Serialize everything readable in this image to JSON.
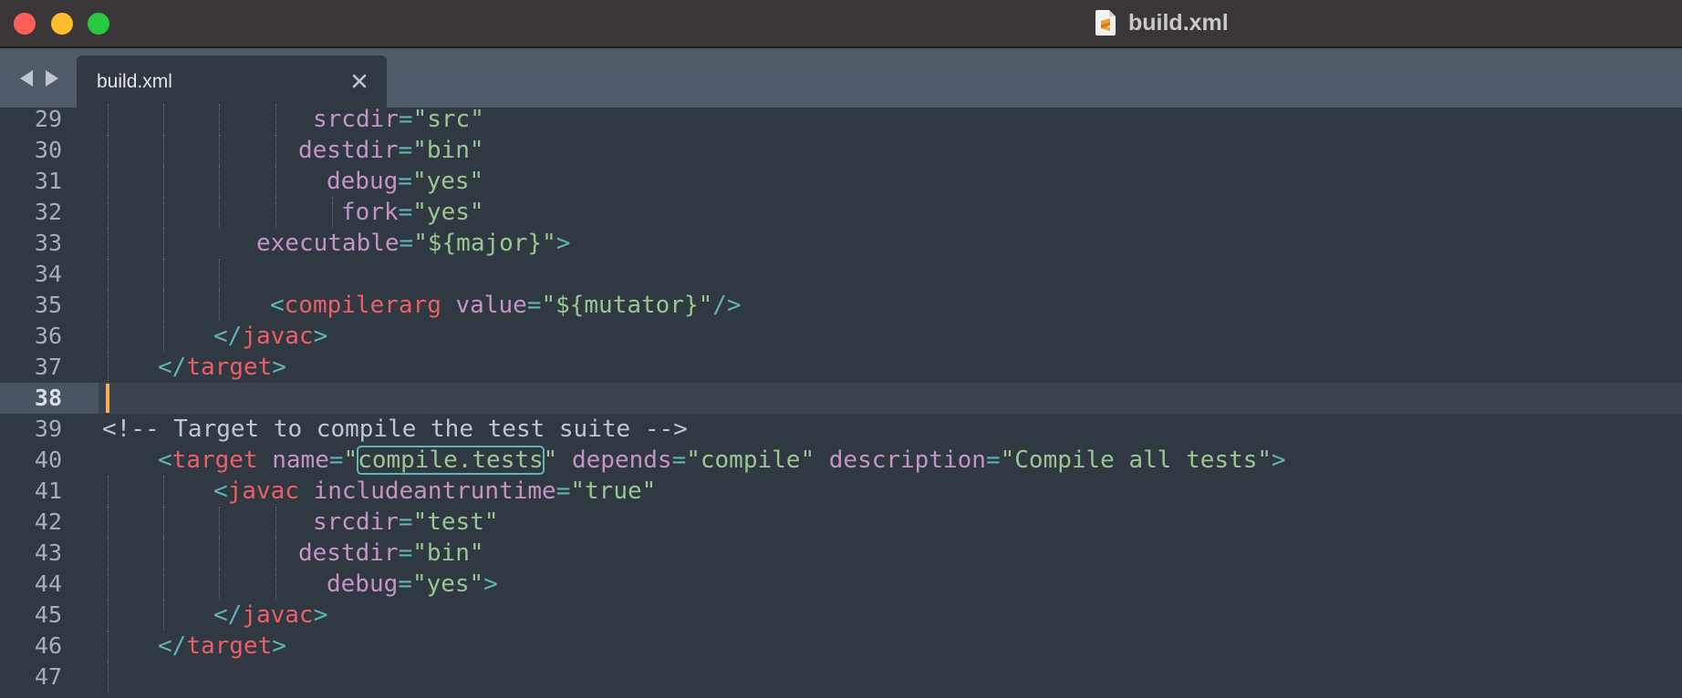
{
  "window": {
    "title": "build.xml",
    "file_icon": "sublime-text-file-icon",
    "controls": [
      "close",
      "minimize",
      "zoom"
    ]
  },
  "tabbar": {
    "nav_back_icon": "triangle-left-icon",
    "nav_forward_icon": "triangle-right-icon",
    "active_tab": {
      "label": "build.xml",
      "close_icon": "close-x-icon"
    }
  },
  "editor": {
    "current_line": "38",
    "colors": {
      "background": "#303841",
      "tag": "#ec5f67",
      "attribute": "#c594c5",
      "string": "#99c794",
      "punctuation": "#5fb4b4",
      "comment": "#c0c5ce",
      "caret": "#f9ae58"
    },
    "lines": [
      {
        "num": "29",
        "tokens": [
          {
            "t": "attr",
            "v": "srcdir"
          },
          {
            "t": "punct",
            "v": "="
          },
          {
            "t": "str",
            "v": "\"src\""
          }
        ]
      },
      {
        "num": "30",
        "tokens": [
          {
            "t": "attr",
            "v": "destdir"
          },
          {
            "t": "punct",
            "v": "="
          },
          {
            "t": "str",
            "v": "\"bin\""
          }
        ]
      },
      {
        "num": "31",
        "tokens": [
          {
            "t": "attr",
            "v": "debug"
          },
          {
            "t": "punct",
            "v": "="
          },
          {
            "t": "str",
            "v": "\"yes\""
          }
        ]
      },
      {
        "num": "32",
        "tokens": [
          {
            "t": "attr",
            "v": "fork"
          },
          {
            "t": "punct",
            "v": "="
          },
          {
            "t": "str",
            "v": "\"yes\""
          }
        ]
      },
      {
        "num": "33",
        "tokens": [
          {
            "t": "attr",
            "v": "executable"
          },
          {
            "t": "punct",
            "v": "="
          },
          {
            "t": "str",
            "v": "\"${major}\""
          },
          {
            "t": "punct",
            "v": ">"
          }
        ]
      },
      {
        "num": "34",
        "tokens": []
      },
      {
        "num": "35",
        "tokens": [
          {
            "t": "punct",
            "v": "<"
          },
          {
            "t": "tag",
            "v": "compilerarg"
          },
          {
            "t": "plain",
            "v": " "
          },
          {
            "t": "attr",
            "v": "value"
          },
          {
            "t": "punct",
            "v": "="
          },
          {
            "t": "str",
            "v": "\"${mutator}\""
          },
          {
            "t": "punct",
            "v": "/>"
          }
        ]
      },
      {
        "num": "36",
        "tokens": [
          {
            "t": "punct",
            "v": "</"
          },
          {
            "t": "tag",
            "v": "javac"
          },
          {
            "t": "punct",
            "v": ">"
          }
        ]
      },
      {
        "num": "37",
        "tokens": [
          {
            "t": "punct",
            "v": "</"
          },
          {
            "t": "tag",
            "v": "target"
          },
          {
            "t": "punct",
            "v": ">"
          }
        ]
      },
      {
        "num": "38",
        "tokens": []
      },
      {
        "num": "39",
        "tokens": [
          {
            "t": "comment",
            "v": "<!-- Target to compile the test suite -->"
          }
        ]
      },
      {
        "num": "40",
        "tokens": [
          {
            "t": "punct",
            "v": "<"
          },
          {
            "t": "tag",
            "v": "target"
          },
          {
            "t": "plain",
            "v": " "
          },
          {
            "t": "attr",
            "v": "name"
          },
          {
            "t": "punct",
            "v": "="
          },
          {
            "t": "str",
            "v": "\""
          },
          {
            "t": "highlight",
            "v": "compile.tests"
          },
          {
            "t": "str",
            "v": "\""
          },
          {
            "t": "plain",
            "v": " "
          },
          {
            "t": "attr",
            "v": "depends"
          },
          {
            "t": "punct",
            "v": "="
          },
          {
            "t": "str",
            "v": "\"compile\""
          },
          {
            "t": "plain",
            "v": " "
          },
          {
            "t": "attr",
            "v": "description"
          },
          {
            "t": "punct",
            "v": "="
          },
          {
            "t": "str",
            "v": "\"Compile all tests\""
          },
          {
            "t": "punct",
            "v": ">"
          }
        ]
      },
      {
        "num": "41",
        "tokens": [
          {
            "t": "punct",
            "v": "<"
          },
          {
            "t": "tag",
            "v": "javac"
          },
          {
            "t": "plain",
            "v": " "
          },
          {
            "t": "attr",
            "v": "includeantruntime"
          },
          {
            "t": "punct",
            "v": "="
          },
          {
            "t": "str",
            "v": "\"true\""
          }
        ]
      },
      {
        "num": "42",
        "tokens": [
          {
            "t": "attr",
            "v": "srcdir"
          },
          {
            "t": "punct",
            "v": "="
          },
          {
            "t": "str",
            "v": "\"test\""
          }
        ]
      },
      {
        "num": "43",
        "tokens": [
          {
            "t": "attr",
            "v": "destdir"
          },
          {
            "t": "punct",
            "v": "="
          },
          {
            "t": "str",
            "v": "\"bin\""
          }
        ]
      },
      {
        "num": "44",
        "tokens": [
          {
            "t": "attr",
            "v": "debug"
          },
          {
            "t": "punct",
            "v": "="
          },
          {
            "t": "str",
            "v": "\"yes\""
          },
          {
            "t": "punct",
            "v": ">"
          }
        ]
      },
      {
        "num": "45",
        "tokens": [
          {
            "t": "punct",
            "v": "</"
          },
          {
            "t": "tag",
            "v": "javac"
          },
          {
            "t": "punct",
            "v": ">"
          }
        ]
      },
      {
        "num": "46",
        "tokens": [
          {
            "t": "punct",
            "v": "</"
          },
          {
            "t": "tag",
            "v": "target"
          },
          {
            "t": "punct",
            "v": ">"
          }
        ]
      },
      {
        "num": "47",
        "tokens": []
      }
    ]
  }
}
